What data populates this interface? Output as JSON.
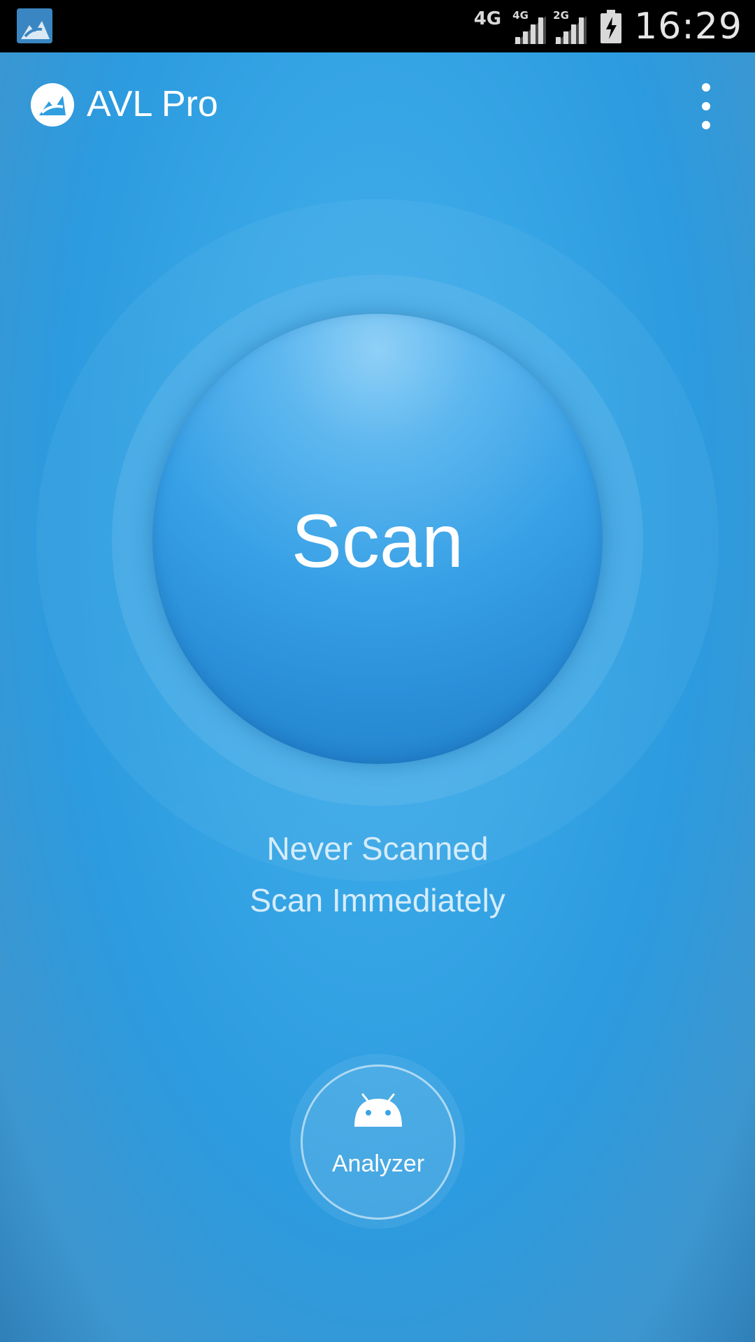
{
  "status_bar": {
    "app_icon": "avl-notification-icon",
    "network_label": "4G",
    "signals": [
      {
        "type_label": "4G",
        "icon": "signal-bars-icon"
      },
      {
        "type_label": "2G",
        "icon": "signal-bars-icon"
      }
    ],
    "battery_icon": "battery-charging-icon",
    "time": "16:29"
  },
  "toolbar": {
    "logo_icon": "avl-logo-icon",
    "title": "AVL Pro",
    "menu_icon": "overflow-menu-icon"
  },
  "scan": {
    "label": "Scan",
    "status": "Never Scanned",
    "hint": "Scan Immediately"
  },
  "analyzer": {
    "icon": "android-icon",
    "label": "Analyzer"
  },
  "colors": {
    "background": "#2f9fe0",
    "scan_button_top": "#8fd0f7",
    "scan_button_bottom": "#1f7dc8",
    "status_text": "#d6ecfa"
  }
}
